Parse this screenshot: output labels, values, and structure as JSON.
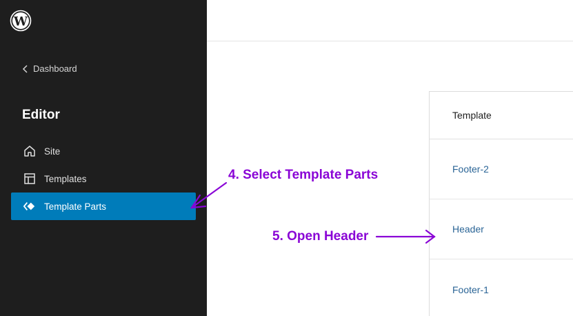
{
  "sidebar": {
    "back_label": "Dashboard",
    "title": "Editor",
    "items": [
      {
        "label": "Site",
        "icon": "home-icon"
      },
      {
        "label": "Templates",
        "icon": "layout-icon"
      },
      {
        "label": "Template Parts",
        "icon": "symbol-filled-icon",
        "active": true
      }
    ]
  },
  "table": {
    "header": "Template",
    "rows": [
      "Footer-2",
      "Header",
      "Footer-1"
    ]
  },
  "annotations": {
    "step4": "4. Select Template Parts",
    "step5": "5. Open Header"
  },
  "colors": {
    "sidebar_bg": "#1e1e1e",
    "active_bg": "#007cba",
    "link": "#2a6496",
    "annotation": "#8a05d6"
  }
}
